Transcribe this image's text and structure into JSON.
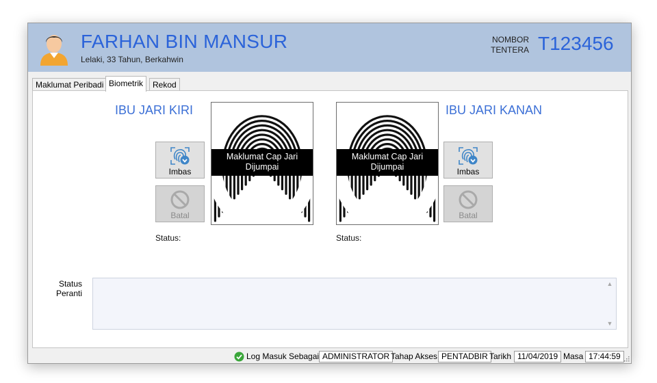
{
  "header": {
    "name": "FARHAN BIN MANSUR",
    "subtitle": "Lelaki, 33 Tahun, Berkahwin",
    "nombor_label_1": "NOMBOR",
    "nombor_label_2": "TENTERA",
    "nombor_value": "T123456",
    "avatar_icon": "user-avatar-icon"
  },
  "tabs": [
    {
      "label": "Maklumat Peribadi",
      "active": false
    },
    {
      "label": "Biometrik",
      "active": true
    },
    {
      "label": "Rekod",
      "active": false
    }
  ],
  "biometric": {
    "left": {
      "title": "IBU JARI KIRI",
      "overlay_line1": "Maklumat Cap Jari",
      "overlay_line2": "Dijumpai",
      "scan_label": "Imbas",
      "cancel_label": "Batal",
      "status_label": "Status:"
    },
    "right": {
      "title": "IBU JARI KANAN",
      "overlay_line1": "Maklumat Cap Jari",
      "overlay_line2": "Dijumpai",
      "scan_label": "Imbas",
      "cancel_label": "Batal",
      "status_label": "Status:"
    }
  },
  "device_status": {
    "label_line1": "Status",
    "label_line2": "Peranti",
    "value": ""
  },
  "statusbar": {
    "login_label": "Log Masuk Sebagai",
    "login_value": "ADMINISTRATOR",
    "access_label": "Tahap Akses",
    "access_value": "PENTADBIR",
    "date_label": "Tarikh",
    "date_value": "11/04/2019",
    "time_label": "Masa",
    "time_value": "17:44:59"
  },
  "colors": {
    "header_bg": "#b0c4de",
    "accent_blue": "#2b63d9",
    "status_ok": "#3aa63a"
  }
}
